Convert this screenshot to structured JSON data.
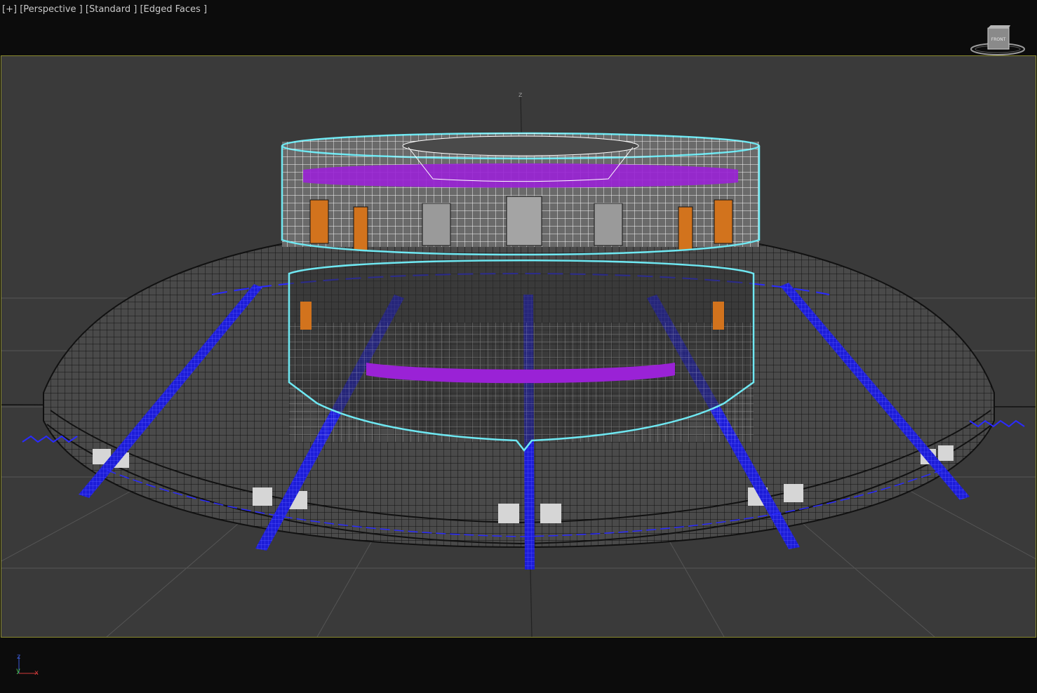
{
  "viewport": {
    "label_plus": "[+]",
    "label_view": "[Perspective ]",
    "label_shading": "[Standard ]",
    "label_faces": "[Edged Faces ]",
    "z_axis_label": "z",
    "border_color": "#8a8a2e",
    "background": "#3a3a3a"
  },
  "viewcube": {
    "face_label": "FRONT",
    "icon": "viewcube-icon"
  },
  "axis_tripod": {
    "z": "z",
    "y": "y",
    "x": "x",
    "colors": {
      "z": "#3b5bd6",
      "y": "#4cc24c",
      "x": "#d23a3a"
    }
  },
  "colors": {
    "selection": "#6fe8f2",
    "wire": "#111111",
    "blue_strips": "#2a2aff",
    "purple": "#9a22d6",
    "orange": "#d2731d"
  }
}
